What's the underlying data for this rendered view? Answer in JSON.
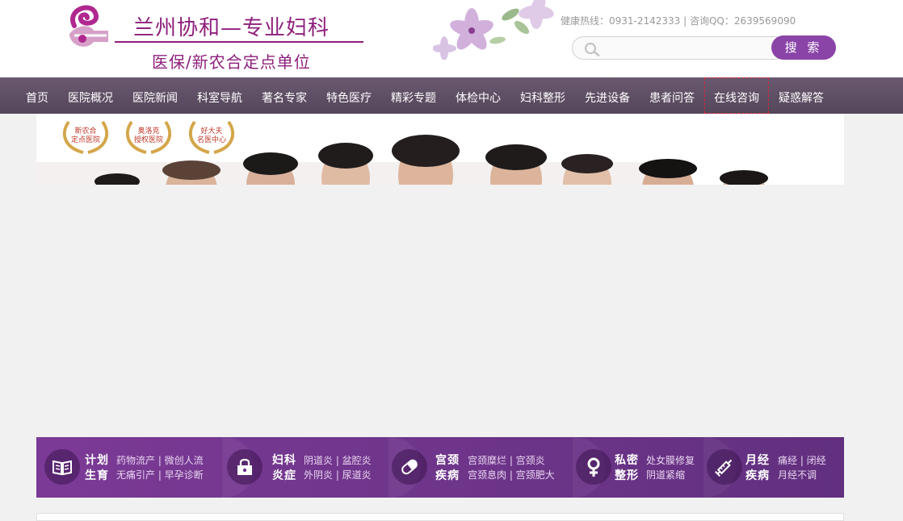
{
  "header": {
    "logo_title": "兰州协和—专业妇科",
    "logo_subtitle": "医保/新农合定点单位",
    "hotline": "健康热线：0931-2142333 | 咨询QQ：2639569090",
    "search_placeholder": "",
    "search_button": "搜 索"
  },
  "nav": {
    "items": [
      {
        "label": "首页"
      },
      {
        "label": "医院概况"
      },
      {
        "label": "医院新闻"
      },
      {
        "label": "科室导航"
      },
      {
        "label": "著名专家"
      },
      {
        "label": "特色医疗"
      },
      {
        "label": "精彩专题"
      },
      {
        "label": "体检中心"
      },
      {
        "label": "妇科整形"
      },
      {
        "label": "先进设备"
      },
      {
        "label": "患者问答"
      },
      {
        "label": "在线咨询"
      },
      {
        "label": "疑惑解答"
      }
    ],
    "active_index": 11
  },
  "banner": {
    "awards": [
      {
        "text": "新农合\n定点医院"
      },
      {
        "text": "奥洛克\n授权医院"
      },
      {
        "text": "好大夫\n名医中心"
      }
    ]
  },
  "categories": [
    {
      "icon": "book-icon",
      "title_1": "计划",
      "title_2": "生育",
      "links_1": "药物流产 | 微创人流",
      "links_2": "无痛引产 | 早孕诊断"
    },
    {
      "icon": "lock-icon",
      "title_1": "妇科",
      "title_2": "炎症",
      "links_1": "阴道炎 | 盆腔炎",
      "links_2": "外阴炎 | 尿道炎"
    },
    {
      "icon": "pill-icon",
      "title_1": "宫颈",
      "title_2": "疾病",
      "links_1": "宫颈糜烂 | 宫颈炎",
      "links_2": "宫颈息肉 | 宫颈肥大"
    },
    {
      "icon": "female-symbol-icon",
      "title_1": "私密",
      "title_2": "整形",
      "links_1": "处女膜修复",
      "links_2": "阴道紧缩"
    },
    {
      "icon": "syringe-icon",
      "title_1": "月经",
      "title_2": "疾病",
      "links_1": "痛经 | 闭经",
      "links_2": "月经不调"
    }
  ],
  "colors": {
    "brand": "#8e1f7c",
    "nav_bg": "#5f4f66",
    "search_button": "#8a44a8",
    "category_bar": "#6f3590"
  }
}
